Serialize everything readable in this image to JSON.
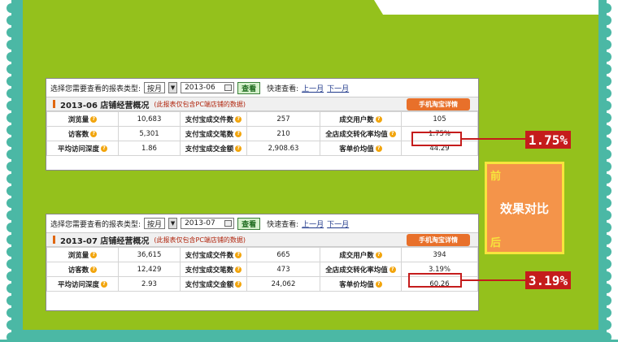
{
  "panel1": {
    "prompt": "选择您需要查看的报表类型:",
    "period_select": "按月",
    "date": "2013-06",
    "view_button": "查看",
    "quick_label": "快速查看:",
    "prev_month": "上一月",
    "next_month": "下一月",
    "title": "2013-06 店铺经营概况",
    "note": "(此报表仅包含PC端店铺的数据)",
    "mobile_button": "手机淘宝详情",
    "rows": [
      [
        "浏览量",
        "10,683",
        "支付宝成交件数",
        "257",
        "成交用户数",
        "105"
      ],
      [
        "访客数",
        "5,301",
        "支付宝成交笔数",
        "210",
        "全店成交转化率均值",
        "1.75%"
      ],
      [
        "平均访问深度",
        "1.86",
        "支付宝成交金额",
        "2,908.63",
        "客单价均值",
        "44.29"
      ]
    ],
    "callout": "1.75%"
  },
  "panel2": {
    "prompt": "选择您需要查看的报表类型:",
    "period_select": "按月",
    "date": "2013-07",
    "view_button": "查看",
    "quick_label": "快速查看:",
    "prev_month": "上一月",
    "next_month": "下一月",
    "title": "2013-07 店铺经营概况",
    "note": "(此报表仅包含PC端店铺的数据)",
    "mobile_button": "手机淘宝详情",
    "rows": [
      [
        "浏览量",
        "36,615",
        "支付宝成交件数",
        "665",
        "成交用户数",
        "394"
      ],
      [
        "访客数",
        "12,429",
        "支付宝成交笔数",
        "473",
        "全店成交转化率均值",
        "3.19%"
      ],
      [
        "平均访问深度",
        "2.93",
        "支付宝成交金额",
        "24,062",
        "客单价均值",
        "60.26"
      ]
    ],
    "callout": "3.19%"
  },
  "compare": {
    "before": "前",
    "middle": "效果对比",
    "after": "后"
  },
  "colors": {
    "background": "#4bb8a5",
    "panel_bg": "#94c11c",
    "highlight": "#c51c1c",
    "badge_orange": "#f4944a"
  }
}
